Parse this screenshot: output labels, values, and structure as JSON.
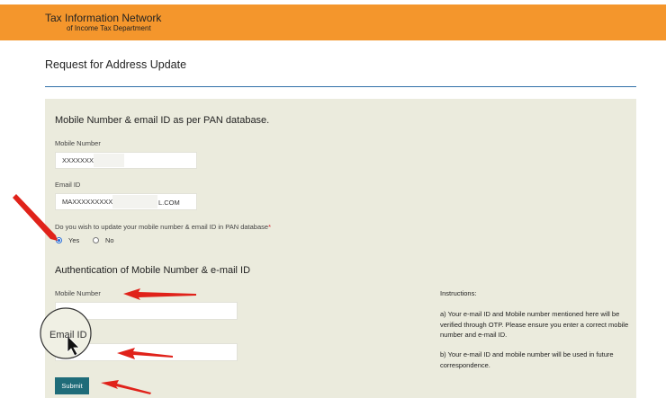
{
  "header": {
    "line1": "Tax Information Network",
    "line2": "of Income Tax Department"
  },
  "page_title": "Request for Address Update",
  "pan_section": {
    "heading": "Mobile Number & email ID as per PAN database.",
    "mobile_label": "Mobile Number",
    "mobile_value": "XXXXXXXC",
    "email_label": "Email ID",
    "email_value_start": "MAXXXXXXXXX",
    "email_value_end": "L.COM",
    "update_question": "Do you wish to update your mobile number & email ID in PAN database",
    "required_mark": "*",
    "option_yes": "Yes",
    "option_no": "No",
    "selected": "Yes"
  },
  "auth_section": {
    "heading": "Authentication of Mobile Number & e-mail ID",
    "mobile_label": "Mobile Number",
    "mobile_value": "",
    "email_label": "Email ID",
    "email_value": ""
  },
  "instructions": {
    "title": "Instructions:",
    "item_a": "a) Your e-mail ID and Mobile number mentioned here will be verified through OTP. Please ensure you enter a correct mobile number and e-mail ID.",
    "item_b": "b) Your e-mail ID and mobile number will be used in future correspondence."
  },
  "submit_label": "Submit",
  "colors": {
    "header": "#f4962c",
    "panel": "#ebebdd",
    "button": "#1f6c79",
    "annotation": "#e0221a"
  }
}
